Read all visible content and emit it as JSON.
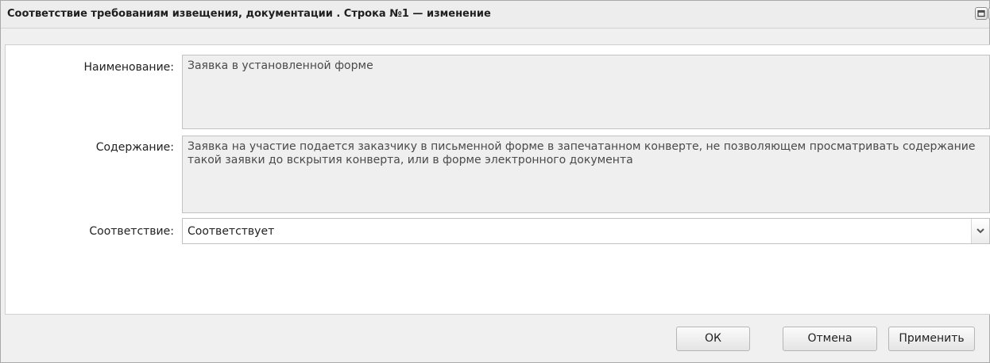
{
  "window": {
    "title": "Соответствие требованиям извещения, документации . Строка №1 — изменение",
    "tools": {
      "maximize_icon": "maximize-icon",
      "close_icon": "close-icon"
    }
  },
  "form": {
    "name": {
      "label": "Наименование:",
      "value": "Заявка в установленной форме"
    },
    "content": {
      "label": "Содержание:",
      "value": "Заявка на участие подается заказчику в письменной форме в запечатанном конверте, не позволяющем просматривать содержание такой заявки до вскрытия конверта, или в форме электронного документа"
    },
    "compliance": {
      "label": "Соответствие:",
      "value": "Соответствует",
      "trigger_icon": "chevron-down-icon"
    }
  },
  "buttons": {
    "ok": "ОК",
    "cancel": "Отмена",
    "apply": "Применить"
  },
  "colors": {
    "window_bg": "#f0f0f0",
    "readonly_field_bg": "#efefef",
    "border": "#c2c2c2"
  }
}
